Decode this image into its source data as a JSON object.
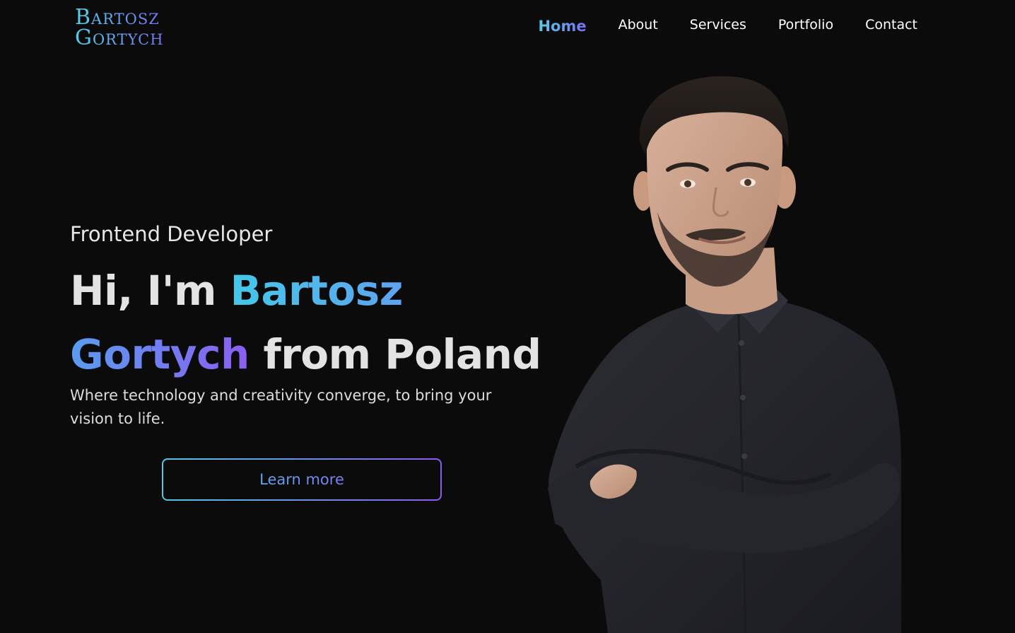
{
  "logo": {
    "line1": "Bartosz",
    "line2": "Gortych"
  },
  "nav": {
    "items": [
      {
        "label": "Home",
        "active": true
      },
      {
        "label": "About",
        "active": false
      },
      {
        "label": "Services",
        "active": false
      },
      {
        "label": "Portfolio",
        "active": false
      },
      {
        "label": "Contact",
        "active": false
      }
    ]
  },
  "hero": {
    "subtitle": "Frontend Developer",
    "greeting": "Hi, I'm",
    "first_name": "Bartosz",
    "last_name": "Gortych",
    "origin": "from Poland",
    "tagline": "Where technology and creativity converge, to bring your vision to life.",
    "cta_label": "Learn more"
  },
  "colors": {
    "background": "#0b0b0c",
    "accent_start": "#56cfe8",
    "accent_end": "#8a5cf0",
    "text": "#e3e3e3"
  },
  "icons": {
    "portrait": "person-portrait"
  }
}
